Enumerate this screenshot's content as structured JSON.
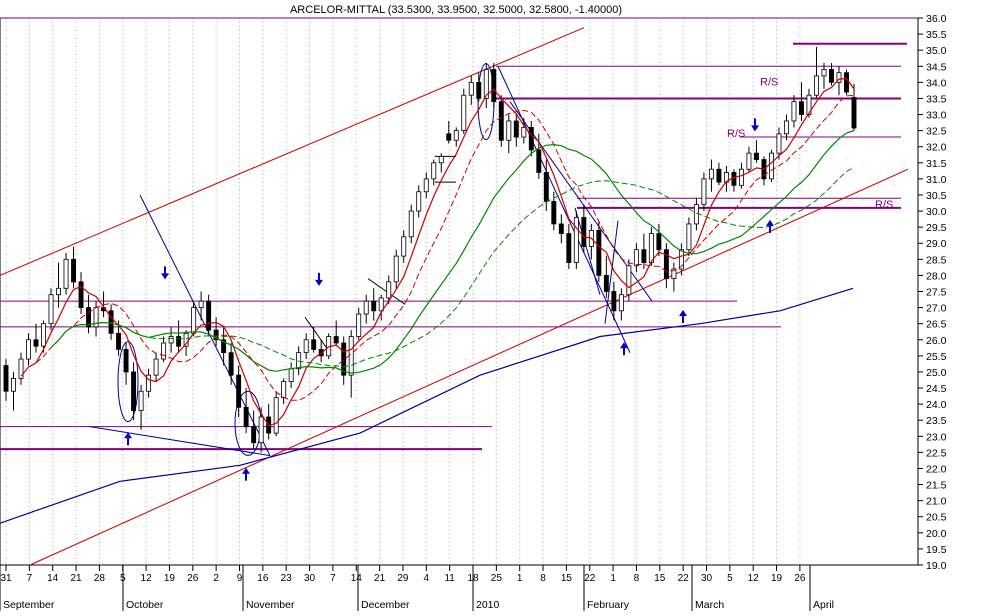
{
  "chart_data": {
    "type": "candlestick",
    "title": "ARCELOR-MITTAL (33.5300, 33.9500, 32.5000, 32.5800, -1.40000)",
    "ylim": [
      19.0,
      36.0
    ],
    "y_ticks": [
      "19.0",
      "19.5",
      "20.0",
      "20.5",
      "21.0",
      "21.5",
      "22.0",
      "22.5",
      "23.0",
      "23.5",
      "24.0",
      "24.5",
      "25.0",
      "25.5",
      "26.0",
      "26.5",
      "27.0",
      "27.5",
      "28.0",
      "28.5",
      "29.0",
      "29.5",
      "30.0",
      "30.5",
      "31.0",
      "31.5",
      "32.0",
      "32.5",
      "33.0",
      "33.5",
      "34.0",
      "34.5",
      "35.0",
      "35.5",
      "36.0"
    ],
    "x_tick_labels": [
      "31",
      "7",
      "14",
      "21",
      "28",
      "5",
      "12",
      "19",
      "26",
      "2",
      "9",
      "16",
      "23",
      "30",
      "7",
      "14",
      "21",
      "29",
      "4",
      "11",
      "18",
      "25",
      "1",
      "8",
      "15",
      "22",
      "1",
      "8",
      "15",
      "22",
      "30",
      "5",
      "12",
      "19",
      "26"
    ],
    "months": [
      "September",
      "October",
      "November",
      "December",
      "2010",
      "February",
      "March",
      "April"
    ],
    "grid": "vertical dotted",
    "annotations": {
      "rs_labels": [
        "R/S",
        "R/S",
        "R/S"
      ]
    },
    "colors": {
      "up": "#ffffff",
      "down": "#000000",
      "ma_fast": "#cc0000",
      "ma_mid": "#008800",
      "ma_slow": "#000099",
      "hlines": "#800080",
      "trend": "#cc0000",
      "channel": "#000099",
      "arrows": "#0000cc"
    },
    "series": [
      {
        "name": "price",
        "values": [
          [
            25.2,
            25.4,
            24.1,
            24.4
          ],
          [
            24.4,
            25.0,
            23.8,
            24.8
          ],
          [
            24.8,
            25.6,
            24.6,
            25.4
          ],
          [
            25.4,
            26.2,
            25.2,
            26.0
          ],
          [
            26.0,
            26.5,
            25.6,
            25.8
          ],
          [
            25.8,
            26.6,
            25.6,
            26.5
          ],
          [
            26.5,
            27.6,
            26.3,
            27.4
          ],
          [
            27.4,
            28.4,
            27.0,
            27.6
          ],
          [
            27.6,
            28.7,
            27.4,
            28.5
          ],
          [
            28.5,
            28.9,
            27.6,
            27.8
          ],
          [
            27.8,
            28.1,
            26.8,
            27.0
          ],
          [
            27.0,
            27.4,
            26.2,
            26.4
          ],
          [
            26.4,
            27.2,
            26.1,
            27.0
          ],
          [
            27.0,
            27.5,
            26.7,
            26.9
          ],
          [
            26.9,
            27.1,
            26.0,
            26.2
          ],
          [
            26.2,
            26.6,
            25.5,
            25.7
          ],
          [
            25.7,
            25.9,
            24.6,
            25.0
          ],
          [
            25.0,
            25.3,
            23.5,
            23.8
          ],
          [
            23.8,
            24.6,
            23.2,
            24.4
          ],
          [
            24.4,
            25.1,
            24.2,
            24.9
          ],
          [
            24.9,
            25.6,
            24.7,
            25.4
          ],
          [
            25.4,
            26.1,
            25.3,
            25.9
          ],
          [
            25.9,
            26.4,
            25.6,
            26.1
          ],
          [
            26.1,
            26.6,
            25.6,
            25.8
          ],
          [
            25.8,
            26.3,
            25.5,
            26.2
          ],
          [
            26.2,
            27.2,
            26.1,
            27.0
          ],
          [
            27.0,
            27.5,
            26.6,
            27.2
          ],
          [
            27.2,
            27.4,
            26.1,
            26.3
          ],
          [
            26.3,
            26.7,
            25.8,
            26.0
          ],
          [
            26.0,
            26.4,
            25.2,
            25.6
          ],
          [
            25.6,
            25.9,
            24.6,
            24.9
          ],
          [
            24.9,
            25.2,
            23.6,
            23.9
          ],
          [
            23.9,
            24.5,
            23.1,
            23.3
          ],
          [
            23.3,
            23.8,
            22.6,
            22.8
          ],
          [
            22.8,
            23.9,
            22.5,
            23.6
          ],
          [
            23.6,
            24.0,
            22.9,
            23.1
          ],
          [
            23.1,
            24.4,
            23.0,
            24.2
          ],
          [
            24.2,
            24.8,
            24.0,
            24.7
          ],
          [
            24.7,
            25.3,
            24.5,
            25.1
          ],
          [
            25.1,
            25.8,
            24.9,
            25.6
          ],
          [
            25.6,
            26.2,
            25.4,
            26.0
          ],
          [
            26.0,
            26.4,
            25.6,
            25.7
          ],
          [
            25.7,
            26.0,
            25.3,
            25.5
          ],
          [
            25.5,
            26.2,
            25.4,
            26.1
          ],
          [
            26.1,
            26.6,
            25.8,
            25.9
          ],
          [
            25.9,
            26.1,
            24.6,
            24.9
          ],
          [
            24.9,
            26.3,
            24.2,
            26.1
          ],
          [
            26.1,
            27.0,
            26.0,
            26.8
          ],
          [
            26.8,
            27.4,
            26.5,
            27.2
          ],
          [
            27.2,
            27.6,
            26.6,
            26.9
          ],
          [
            26.9,
            27.4,
            26.6,
            27.3
          ],
          [
            27.3,
            28.0,
            27.1,
            27.8
          ],
          [
            27.8,
            28.8,
            27.6,
            28.6
          ],
          [
            28.6,
            29.4,
            28.4,
            29.2
          ],
          [
            29.2,
            30.2,
            29.0,
            30.0
          ],
          [
            30.0,
            30.8,
            29.8,
            30.6
          ],
          [
            30.6,
            31.2,
            30.4,
            31.0
          ],
          [
            31.0,
            31.6,
            30.8,
            31.5
          ],
          [
            31.5,
            31.8,
            31.2,
            31.7
          ],
          [
            32.4,
            32.8,
            32.1,
            32.2
          ],
          [
            32.2,
            32.6,
            32.0,
            32.5
          ],
          [
            32.5,
            33.8,
            32.4,
            33.6
          ],
          [
            33.6,
            34.2,
            33.3,
            34.0
          ],
          [
            34.0,
            34.3,
            33.4,
            33.5
          ],
          [
            33.5,
            34.6,
            33.2,
            34.4
          ],
          [
            34.4,
            34.6,
            33.2,
            33.4
          ],
          [
            33.4,
            33.6,
            32.0,
            32.2
          ],
          [
            32.2,
            33.0,
            31.8,
            32.8
          ],
          [
            32.8,
            33.0,
            32.0,
            32.3
          ],
          [
            32.3,
            32.9,
            32.1,
            32.6
          ],
          [
            32.6,
            32.8,
            31.7,
            31.9
          ],
          [
            31.9,
            32.4,
            31.0,
            31.2
          ],
          [
            31.2,
            31.6,
            30.0,
            30.3
          ],
          [
            30.3,
            30.6,
            29.4,
            29.6
          ],
          [
            29.6,
            29.9,
            29.0,
            29.3
          ],
          [
            29.3,
            29.6,
            28.2,
            28.4
          ],
          [
            28.4,
            30.0,
            28.2,
            29.8
          ],
          [
            29.8,
            30.2,
            28.7,
            28.9
          ],
          [
            28.9,
            29.6,
            28.5,
            29.4
          ],
          [
            29.4,
            29.7,
            27.8,
            28.0
          ],
          [
            28.0,
            28.6,
            27.3,
            27.5
          ],
          [
            27.5,
            27.8,
            26.6,
            26.9
          ],
          [
            26.9,
            27.6,
            26.6,
            27.4
          ],
          [
            27.4,
            28.5,
            27.2,
            28.3
          ],
          [
            28.3,
            29.0,
            28.1,
            28.8
          ],
          [
            28.8,
            29.3,
            28.2,
            28.4
          ],
          [
            28.4,
            29.5,
            28.3,
            29.3
          ],
          [
            29.3,
            29.6,
            28.6,
            28.8
          ],
          [
            28.8,
            29.0,
            27.6,
            27.9
          ],
          [
            27.9,
            28.4,
            27.5,
            28.2
          ],
          [
            28.2,
            29.0,
            28.0,
            28.8
          ],
          [
            28.8,
            29.8,
            28.6,
            29.6
          ],
          [
            29.6,
            30.4,
            29.4,
            30.2
          ],
          [
            30.2,
            31.2,
            30.0,
            31.0
          ],
          [
            31.0,
            31.6,
            30.6,
            31.3
          ],
          [
            31.3,
            31.5,
            30.8,
            30.9
          ],
          [
            30.9,
            31.4,
            30.6,
            31.2
          ],
          [
            31.2,
            31.3,
            30.6,
            30.8
          ],
          [
            30.8,
            31.5,
            30.7,
            31.3
          ],
          [
            31.3,
            32.0,
            31.2,
            31.8
          ],
          [
            31.8,
            32.2,
            31.5,
            31.6
          ],
          [
            31.6,
            31.7,
            30.8,
            31.0
          ],
          [
            31.0,
            31.9,
            30.9,
            31.8
          ],
          [
            31.8,
            32.6,
            31.6,
            32.4
          ],
          [
            32.4,
            33.0,
            32.2,
            32.8
          ],
          [
            32.8,
            33.6,
            32.6,
            33.4
          ],
          [
            33.4,
            34.0,
            32.8,
            33.0
          ],
          [
            33.0,
            33.8,
            32.9,
            33.6
          ],
          [
            33.6,
            35.1,
            33.5,
            34.2
          ],
          [
            34.2,
            34.6,
            33.8,
            34.4
          ],
          [
            34.4,
            34.6,
            33.9,
            34.0
          ],
          [
            34.0,
            34.5,
            33.6,
            34.3
          ],
          [
            34.3,
            34.4,
            33.6,
            33.7
          ],
          [
            33.53,
            33.95,
            32.5,
            32.58
          ]
        ]
      }
    ]
  }
}
